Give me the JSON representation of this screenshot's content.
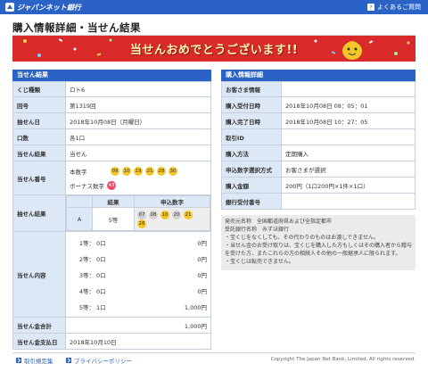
{
  "header": {
    "logo_text": "ジャパンネット銀行",
    "faq_label": "よくあるご質問",
    "brand_color": "#2a63c5"
  },
  "page": {
    "title": "購入情報詳細・当せん結果",
    "banner_text": "当せんおめでとうございます!!"
  },
  "result_panel": {
    "heading": "当せん結果",
    "rows": {
      "kuji_type_label": "くじ種類",
      "kuji_type_value": "ロト6",
      "round_label": "回号",
      "round_value": "第1319回",
      "draw_date_label": "抽せん日",
      "draw_date_value": "2018年10月08日（月曜日）",
      "units_label": "口数",
      "units_value": "各1口",
      "result_label": "当せん結果",
      "result_value": "当せん",
      "winning_numbers_label": "当せん番号",
      "main_numbers_label": "本数字",
      "main_numbers": [
        "09",
        "10",
        "19",
        "21",
        "28",
        "30"
      ],
      "bonus_label": "ボーナス数字",
      "bonus_number": "43",
      "detail_label": "抽せん結果",
      "detail_col_result": "結果",
      "detail_col_numbers": "申込数字",
      "detail_row_id": "A",
      "detail_row_result": "5等",
      "detail_row_numbers": [
        "07",
        "08",
        "10",
        "20",
        "21",
        "28"
      ],
      "detail_row_matched": [
        false,
        false,
        true,
        false,
        true,
        true
      ],
      "content_label": "当せん内容",
      "content_rows": [
        {
          "grade": "1等：",
          "count": "0口",
          "amount": "0円"
        },
        {
          "grade": "2等：",
          "count": "0口",
          "amount": "0円"
        },
        {
          "grade": "3等：",
          "count": "0口",
          "amount": "0円"
        },
        {
          "grade": "4等：",
          "count": "0口",
          "amount": "0円"
        },
        {
          "grade": "5等：",
          "count": "1口",
          "amount": "1,000円"
        }
      ],
      "total_label": "当せん金合計",
      "total_value": "1,000円",
      "payout_date_label": "当せん金支払日",
      "payout_date_value": "2018年10月10日"
    }
  },
  "purchase_panel": {
    "heading": "購入情報詳細",
    "rows": {
      "customer_label": "お客さま情報",
      "customer_value": "",
      "accept_time_label": "購入受付日時",
      "accept_time_value": "2018年10月08日 08：05：01",
      "complete_time_label": "購入完了日時",
      "complete_time_value": "2018年10月08日 10：27：05",
      "txn_id_label": "取引ID",
      "txn_id_value": "",
      "method_label": "購入方法",
      "method_value": "定期購入",
      "selection_label": "申込数字選択方式",
      "selection_value": "お客さまが選択",
      "amount_label": "購入金額",
      "amount_value": "200円（1口200円×1件×1口）",
      "bank_date_label": "銀行受付番号",
      "bank_date_value": ""
    }
  },
  "notes": {
    "issuer": "発売元名称　全国都道府県および全指定都市",
    "bank": "受託銀行名称　みずほ銀行",
    "bullets": [
      "・宝くじをなくしても、その代わりのものはお渡しできません。",
      "・当せん金のお受け取りは、宝くじを購入した方もしくはその購入者から贈与を受けた方、またこれらの方の相続人その他の一般継承人に限られます。",
      "・宝くじは転売できません。"
    ]
  },
  "footer": {
    "link1": "取引規定集",
    "link2": "プライバシーポリシー",
    "copyright": "Copyright The Japan Net Bank, Limited. All rights reserved."
  }
}
